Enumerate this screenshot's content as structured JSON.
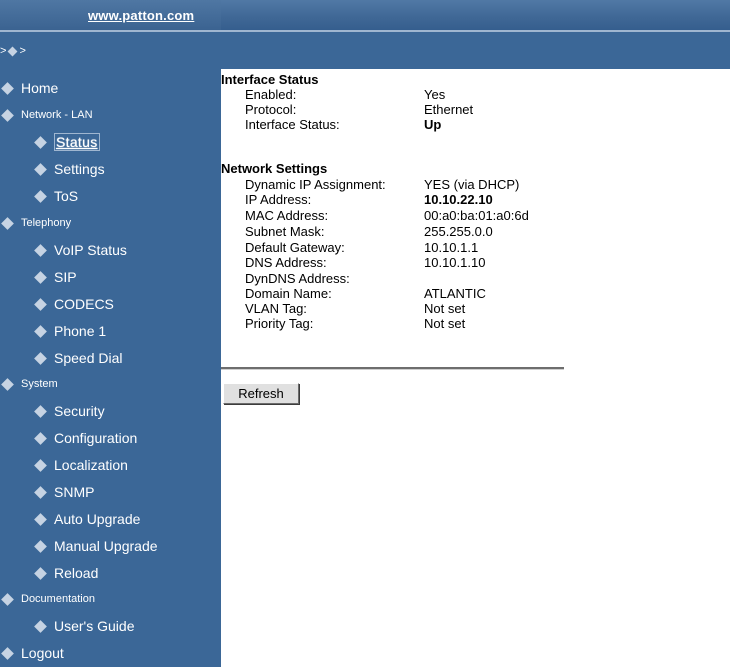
{
  "header": {
    "brand_link": "www.patton.com"
  },
  "breadcrumb": {
    "prefix": ">",
    "suffix": ">"
  },
  "sidebar": {
    "items": [
      {
        "label": "Home"
      },
      {
        "label": "Network - LAN"
      },
      {
        "label": "Status"
      },
      {
        "label": "Settings"
      },
      {
        "label": "ToS"
      },
      {
        "label": "Telephony"
      },
      {
        "label": "VoIP Status"
      },
      {
        "label": "SIP"
      },
      {
        "label": "CODECS"
      },
      {
        "label": "Phone 1"
      },
      {
        "label": "Speed Dial"
      },
      {
        "label": "System"
      },
      {
        "label": "Security"
      },
      {
        "label": "Configuration"
      },
      {
        "label": "Localization"
      },
      {
        "label": "SNMP"
      },
      {
        "label": "Auto Upgrade"
      },
      {
        "label": "Manual Upgrade"
      },
      {
        "label": "Reload"
      },
      {
        "label": "Documentation"
      },
      {
        "label": "User's Guide"
      },
      {
        "label": "Logout"
      }
    ],
    "active": "Status"
  },
  "interface_status": {
    "title": "Interface Status",
    "rows": [
      {
        "label": "Enabled:",
        "value": "Yes"
      },
      {
        "label": "Protocol:",
        "value": "Ethernet"
      },
      {
        "label": "Interface Status:",
        "value": "Up"
      }
    ]
  },
  "network_settings": {
    "title": "Network Settings",
    "rows": [
      {
        "label": "Dynamic IP Assignment:",
        "value": "YES (via DHCP)"
      },
      {
        "label": "IP Address:",
        "value": "10.10.22.10"
      },
      {
        "label": "MAC Address:",
        "value": "00:a0:ba:01:a0:6d"
      },
      {
        "label": "Subnet Mask:",
        "value": "255.255.0.0"
      },
      {
        "label": "Default Gateway:",
        "value": "10.10.1.1"
      },
      {
        "label": "DNS Address:",
        "value": "10.10.1.10"
      },
      {
        "label": "DynDNS Address:",
        "value": ""
      },
      {
        "label": "Domain Name:",
        "value": "ATLANTIC"
      },
      {
        "label": "VLAN Tag:",
        "value": "Not set"
      },
      {
        "label": "Priority Tag:",
        "value": "Not set"
      }
    ]
  },
  "actions": {
    "refresh_label": "Refresh"
  },
  "colors": {
    "sidebar_bg": "#3b6797",
    "header_bg": "#4a72a0",
    "bullet": "#c6d3e3",
    "content_bg": "#ffffff"
  }
}
